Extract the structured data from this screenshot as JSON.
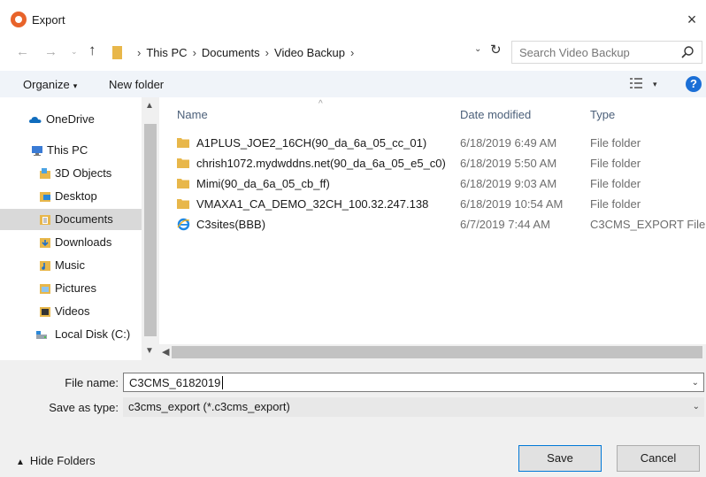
{
  "window": {
    "title": "Export",
    "close_glyph": "×"
  },
  "address": {
    "crumbs": [
      "This PC",
      "Documents",
      "Video Backup"
    ],
    "separator": "›",
    "search_placeholder": "Search Video Backup"
  },
  "toolbar": {
    "organize_label": "Organize",
    "new_folder_label": "New folder",
    "help_glyph": "?"
  },
  "nav": {
    "items": [
      {
        "label": "OneDrive",
        "icon": "cloud-icon"
      },
      {
        "label": "This PC",
        "icon": "computer-icon"
      },
      {
        "label": "3D Objects",
        "icon": "cube-icon"
      },
      {
        "label": "Desktop",
        "icon": "desktop-folder-icon"
      },
      {
        "label": "Documents",
        "icon": "documents-folder-icon",
        "selected": true
      },
      {
        "label": "Downloads",
        "icon": "downloads-folder-icon"
      },
      {
        "label": "Music",
        "icon": "music-folder-icon"
      },
      {
        "label": "Pictures",
        "icon": "pictures-folder-icon"
      },
      {
        "label": "Videos",
        "icon": "videos-folder-icon"
      },
      {
        "label": "Local Disk (C:)",
        "icon": "disk-icon"
      }
    ]
  },
  "files": {
    "columns": {
      "name": "Name",
      "date": "Date modified",
      "type": "Type"
    },
    "rows": [
      {
        "name": "A1PLUS_JOE2_16CH(90_da_6a_05_cc_01)",
        "date": "6/18/2019 6:49 AM",
        "type": "File folder",
        "icon": "folder-icon"
      },
      {
        "name": "chrish1072.mydwddns.net(90_da_6a_05_e5_c0)",
        "date": "6/18/2019 5:50 AM",
        "type": "File folder",
        "icon": "folder-icon"
      },
      {
        "name": "Mimi(90_da_6a_05_cb_ff)",
        "date": "6/18/2019 9:03 AM",
        "type": "File folder",
        "icon": "folder-icon"
      },
      {
        "name": "VMAXA1_CA_DEMO_32CH_100.32.247.138",
        "date": "6/18/2019 10:54 AM",
        "type": "File folder",
        "icon": "folder-icon"
      },
      {
        "name": "C3sites(BBB)",
        "date": "6/7/2019 7:44 AM",
        "type": "C3CMS_EXPORT File",
        "icon": "ie-file-icon"
      }
    ]
  },
  "form": {
    "file_name_label": "File name:",
    "file_name_value": "C3CMS_6182019",
    "save_as_label": "Save as type:",
    "save_as_value": "c3cms_export (*.c3cms_export)"
  },
  "footer": {
    "hide_folders_label": "Hide Folders",
    "save_label": "Save",
    "cancel_label": "Cancel"
  },
  "colors": {
    "accent": "#0078d7",
    "folder": "#e8b74a",
    "toolbar_bg": "#f0f4f9",
    "selected": "#d9d9d9"
  }
}
